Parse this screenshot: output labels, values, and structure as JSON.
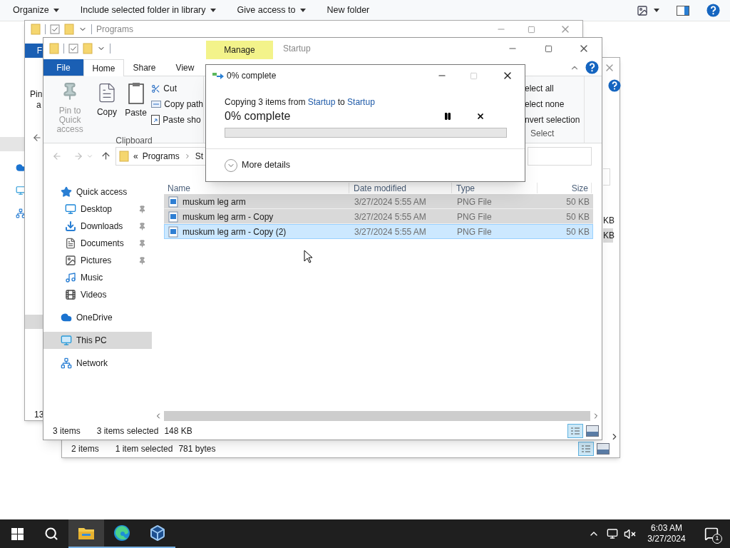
{
  "background_window": {
    "toolbar": [
      {
        "label": "Organize",
        "dropdown": true
      },
      {
        "label": "Include selected folder in library",
        "dropdown": true
      },
      {
        "label": "Give access to",
        "dropdown": true
      },
      {
        "label": "New folder",
        "dropdown": false
      }
    ]
  },
  "programs_window": {
    "title": "Programs",
    "file_tab": "F",
    "ribbon_fragment": "Pin",
    "ribbon_fragment_2": "a",
    "status_fragment": "13"
  },
  "back_window": {
    "size_fragments": [
      {
        "text": "KB",
        "selected": false
      },
      {
        "text": "KB",
        "selected": true
      }
    ],
    "status_items": "2 items",
    "status_selection": "1 item selected",
    "status_size": "781 bytes"
  },
  "main_window": {
    "context_tab": "Manage",
    "title": "Startup",
    "tabs": [
      {
        "label": "File",
        "kind": "file",
        "selected": false
      },
      {
        "label": "Home",
        "kind": "tab",
        "selected": true
      },
      {
        "label": "Share",
        "kind": "tab",
        "selected": false
      },
      {
        "label": "View",
        "kind": "tab",
        "selected": false
      }
    ],
    "clipboard": {
      "pin": {
        "label": "Pin to Quick access",
        "disabled": true
      },
      "copy": "Copy",
      "paste": "Paste",
      "small": [
        {
          "label": "Cut",
          "kind": "cut"
        },
        {
          "label": "Copy path",
          "kind": "path"
        },
        {
          "label": "Paste sho",
          "kind": "shortcut"
        }
      ],
      "group": "Clipboard"
    },
    "select": {
      "items": [
        "elect all",
        "elect none",
        "nvert selection"
      ],
      "group": "Select"
    },
    "address": {
      "overflow": "«",
      "segments": [
        "Programs",
        "St"
      ]
    },
    "columns": [
      "Name",
      "Date modified",
      "Type",
      "Size"
    ],
    "nav": [
      {
        "label": "Quick access",
        "kind": "star",
        "pinned": false,
        "selected": false,
        "children": [
          {
            "label": "Desktop",
            "kind": "desktop",
            "pinned": true,
            "selected": false
          },
          {
            "label": "Downloads",
            "kind": "download",
            "pinned": true,
            "selected": false
          },
          {
            "label": "Documents",
            "kind": "document",
            "pinned": true,
            "selected": false
          },
          {
            "label": "Pictures",
            "kind": "pictures",
            "pinned": true,
            "selected": false
          },
          {
            "label": "Music",
            "kind": "music",
            "pinned": false,
            "selected": false
          },
          {
            "label": "Videos",
            "kind": "videos",
            "pinned": false,
            "selected": false
          }
        ]
      },
      {
        "label": "OneDrive",
        "kind": "cloud",
        "pinned": false,
        "selected": false
      },
      {
        "label": "This PC",
        "kind": "pc",
        "pinned": false,
        "selected": true
      },
      {
        "label": "Network",
        "kind": "network",
        "pinned": false,
        "selected": false
      }
    ],
    "files": [
      {
        "name": "muskum leg arm",
        "date": "3/27/2024 5:55 AM",
        "type": "PNG File",
        "size": "50 KB",
        "selected": true,
        "focused": false
      },
      {
        "name": "muskum leg arm - Copy",
        "date": "3/27/2024 5:55 AM",
        "type": "PNG File",
        "size": "50 KB",
        "selected": true,
        "focused": false
      },
      {
        "name": "muskum leg arm - Copy (2)",
        "date": "3/27/2024 5:55 AM",
        "type": "PNG File",
        "size": "50 KB",
        "selected": true,
        "focused": true
      }
    ],
    "status_items": "3 items",
    "status_selection": "3 items selected",
    "status_size": "148 KB"
  },
  "dialog": {
    "title": "0% complete",
    "message": [
      {
        "text": "Copying 3 items from ",
        "kind": "plain"
      },
      {
        "text": "Startup",
        "kind": "link"
      },
      {
        "text": " to ",
        "kind": "plain"
      },
      {
        "text": "Startup",
        "kind": "link"
      }
    ],
    "progress_label": "0% complete",
    "maximize_disabled": true,
    "more_details": "More details"
  },
  "taskbar": {
    "apps": [
      {
        "kind": "explorer",
        "active": true
      },
      {
        "kind": "edge",
        "active": false
      },
      {
        "kind": "virtualbox",
        "active": false
      }
    ],
    "volume_muted": true,
    "time": "6:03 AM",
    "date": "3/27/2024",
    "notifications": "1"
  }
}
